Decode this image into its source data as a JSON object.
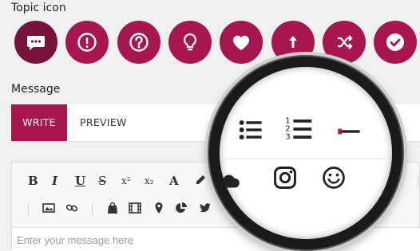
{
  "topic_section": {
    "label": "Topic icon",
    "icons": [
      {
        "name": "chat-icon",
        "selected": true
      },
      {
        "name": "exclamation-icon",
        "selected": false
      },
      {
        "name": "question-icon",
        "selected": false
      },
      {
        "name": "lightbulb-icon",
        "selected": false
      },
      {
        "name": "heart-icon",
        "selected": false
      },
      {
        "name": "arrow-up-icon",
        "selected": false
      },
      {
        "name": "shuffle-icon",
        "selected": false
      },
      {
        "name": "checkmark-icon",
        "selected": false
      }
    ]
  },
  "message_section": {
    "label": "Message",
    "tabs": [
      {
        "label": "WRITE",
        "active": true
      },
      {
        "label": "PREVIEW",
        "active": false
      }
    ]
  },
  "toolbar": {
    "bold": "B",
    "italic": "I",
    "underline": "U",
    "strikethrough": "S",
    "superscript": "x²",
    "subscript": "x₂",
    "font_color": "A"
  },
  "editor": {
    "placeholder": "Enter your message here"
  },
  "colors": {
    "accent": "#a8164f",
    "accent_selected": "#77123a",
    "background": "#f0f0f0"
  }
}
